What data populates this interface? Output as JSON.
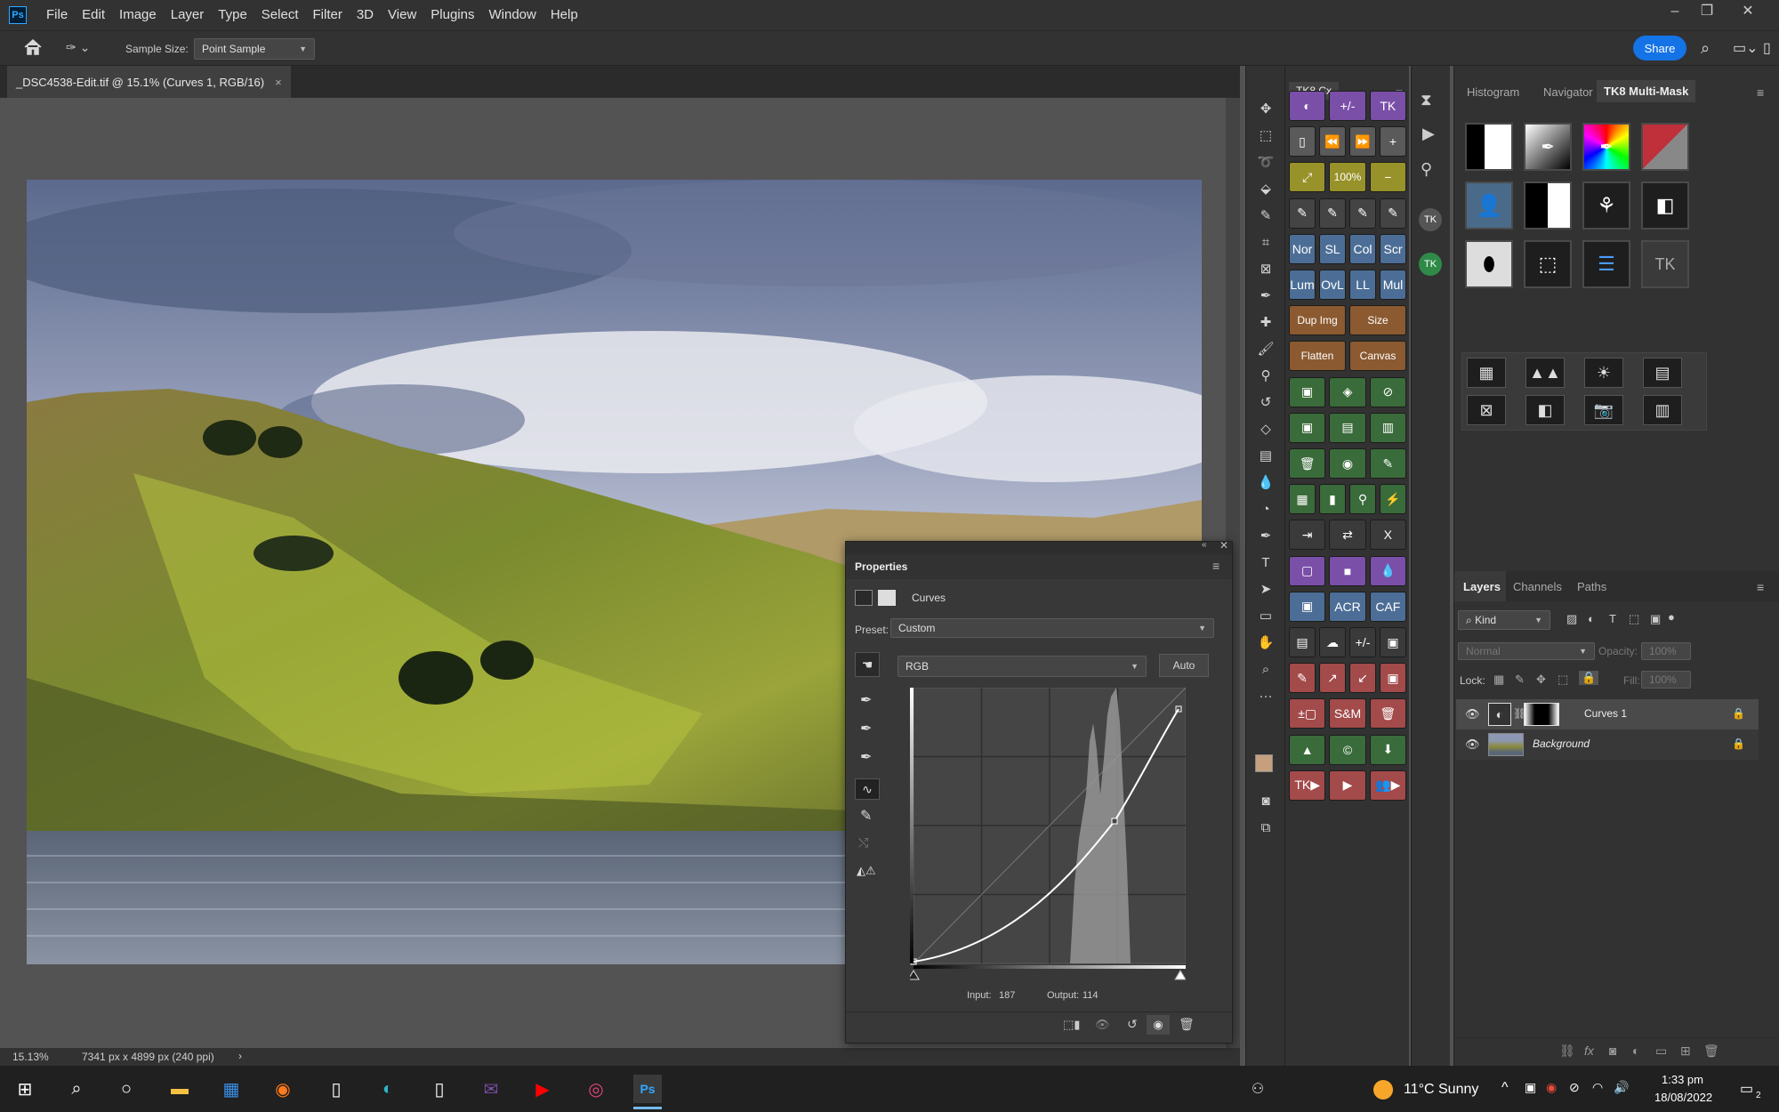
{
  "app": {
    "logo": "Ps"
  },
  "menu": [
    "File",
    "Edit",
    "Image",
    "Layer",
    "Type",
    "Select",
    "Filter",
    "3D",
    "View",
    "Plugins",
    "Window",
    "Help"
  ],
  "options": {
    "sample_size_label": "Sample Size:",
    "sample_size_value": "Point Sample",
    "share_label": "Share"
  },
  "document": {
    "tab_title": "_DSC4538-Edit.tif @ 15.1% (Curves 1, RGB/16)",
    "close_glyph": "×"
  },
  "status": {
    "zoom": "15.13%",
    "info": "7341 px x 4899 px (240 ppi)",
    "arrow": "›"
  },
  "properties": {
    "title": "Properties",
    "adjustment": "Curves",
    "preset_label": "Preset:",
    "preset_value": "Custom",
    "channel_value": "RGB",
    "auto_label": "Auto",
    "input_label": "Input:",
    "input_value": "187",
    "output_label": "Output:",
    "output_value": "114"
  },
  "tk8cx": {
    "title": "TK8 Cx",
    "rows": [
      [
        "◐",
        "+/-",
        "TK"
      ],
      [
        "▯",
        "⏪",
        "⏩",
        "+"
      ],
      [
        "⤢",
        "100%",
        "−"
      ],
      [
        "✎",
        "✎",
        "✎",
        "✎"
      ],
      [
        "Nor",
        "SL",
        "Col",
        "Scr"
      ],
      [
        "Lum",
        "OvL",
        "LL",
        "Mul"
      ],
      [
        "Dup Img",
        "Size"
      ],
      [
        "Flatten",
        "Canvas"
      ],
      [
        "▣",
        "◈",
        "⊘"
      ],
      [
        "▣",
        "▤",
        "▥"
      ],
      [
        "🗑",
        "◉",
        "✎"
      ],
      [
        "▦",
        "▮",
        "⚲",
        "⚡"
      ],
      [
        "⇥",
        "⇄",
        "X"
      ],
      [
        "▢",
        "■",
        "💧"
      ],
      [
        "▣",
        "ACR",
        "CAF"
      ],
      [
        "▤",
        "☁",
        "+/-",
        "▣"
      ],
      [
        "✎",
        "↗",
        "↙",
        "▣"
      ],
      [
        "±▢",
        "S&M",
        "🗑"
      ],
      [
        "▲",
        "©",
        "⬇"
      ],
      [
        "TK▶",
        "▶",
        "👥▶"
      ]
    ]
  },
  "right_tabs": {
    "histogram": "Histogram",
    "navigator": "Navigator",
    "multimask": "TK8 Multi-Mask"
  },
  "layers_panel": {
    "tabs": [
      "Layers",
      "Channels",
      "Paths"
    ],
    "kind_label": "Kind",
    "blend_mode": "Normal",
    "opacity_label": "Opacity:",
    "opacity_value": "100%",
    "lock_label": "Lock:",
    "fill_label": "Fill:",
    "fill_value": "100%",
    "layers": [
      {
        "name": "Curves 1"
      },
      {
        "name": "Background"
      }
    ]
  },
  "taskbar": {
    "weather": "11°C  Sunny",
    "time": "1:33 pm",
    "date": "18/08/2022",
    "notifications": "2"
  },
  "colors": {
    "accent": "#1473e6",
    "panel": "#323232",
    "canvas_bg": "#535353"
  }
}
